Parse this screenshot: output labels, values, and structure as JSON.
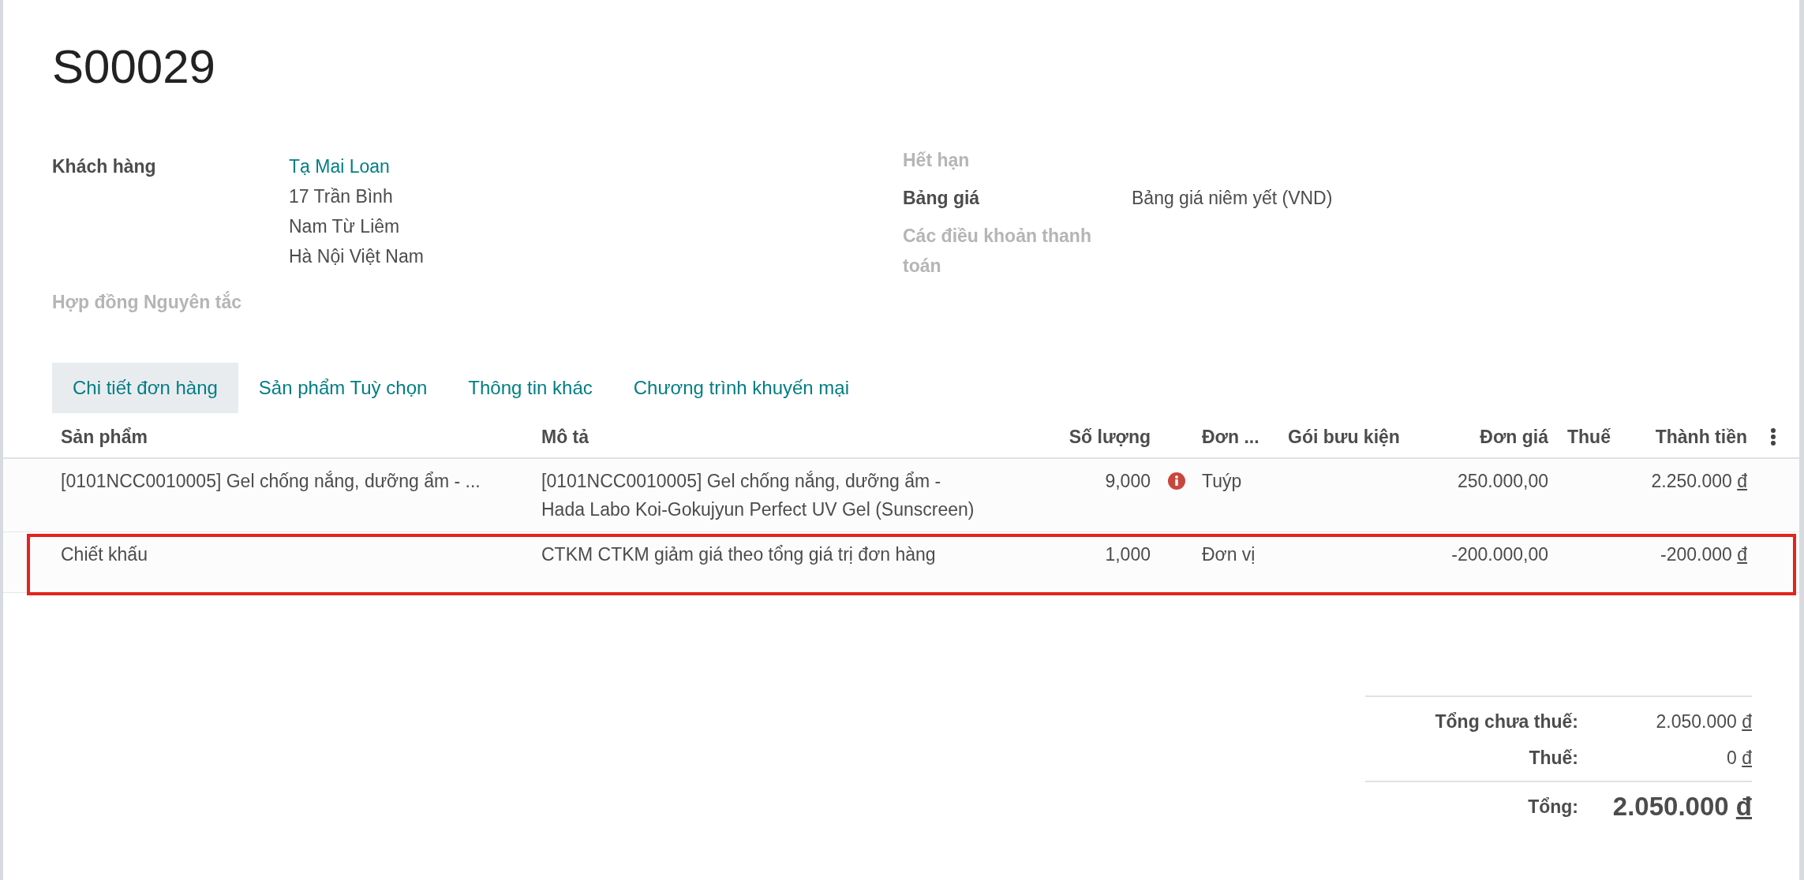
{
  "title": "S00029",
  "fields_left": [
    {
      "label": "Khách hàng",
      "label_muted": false,
      "link": "Tạ Mai Loan",
      "lines": [
        "17 Trần Bình",
        "Nam Từ Liêm",
        "Hà Nội Việt Nam"
      ]
    },
    {
      "label": "Hợp đồng Nguyên tắc",
      "label_muted": true
    }
  ],
  "fields_right": [
    {
      "label": "Hết hạn",
      "label_muted": true
    },
    {
      "label": "Bảng giá",
      "label_muted": false,
      "value": "Bảng giá niêm yết (VND)"
    },
    {
      "label": "Các điều khoản thanh toán",
      "label_muted": true
    }
  ],
  "tabs": [
    {
      "label": "Chi tiết đơn hàng",
      "selected": true
    },
    {
      "label": "Sản phẩm Tuỳ chọn",
      "selected": false
    },
    {
      "label": "Thông tin khác",
      "selected": false
    },
    {
      "label": "Chương trình khuyến mại",
      "selected": false
    }
  ],
  "table": {
    "columns": [
      "Sản phẩm",
      "Mô tả",
      "Số lượng",
      "Đơn ...",
      "Gói bưu kiện",
      "Đơn giá",
      "Thuế",
      "Thành tiền"
    ],
    "rows": [
      {
        "product": "[0101NCC0010005] Gel chống nắng, dưỡng ẩm - ...",
        "description": "[0101NCC0010005] Gel chống nắng, dưỡng ẩm - Hada Labo Koi-Gokujyun Perfect UV Gel (Sunscreen)",
        "quantity": "9,000",
        "warning": true,
        "unit": "Tuýp",
        "unit_price": "250.000,00",
        "subtotal": "2.250.000",
        "currency": "đ",
        "highlighted": false
      },
      {
        "product": "Chiết khấu",
        "description": "CTKM CTKM giảm giá theo tổng giá trị đơn hàng",
        "quantity": "1,000",
        "warning": false,
        "unit": "Đơn vị",
        "unit_price": "-200.000,00",
        "subtotal": "-200.000",
        "currency": "đ",
        "highlighted": true
      }
    ]
  },
  "totals": [
    {
      "label": "Tổng chưa thuế:",
      "amount": "2.050.000",
      "currency": "đ",
      "kind": "line"
    },
    {
      "label": "Thuế:",
      "amount": "0",
      "currency": "đ",
      "kind": "line"
    },
    {
      "label": "Tổng:",
      "amount": "2.050.000",
      "currency": "đ",
      "kind": "grand"
    }
  ]
}
